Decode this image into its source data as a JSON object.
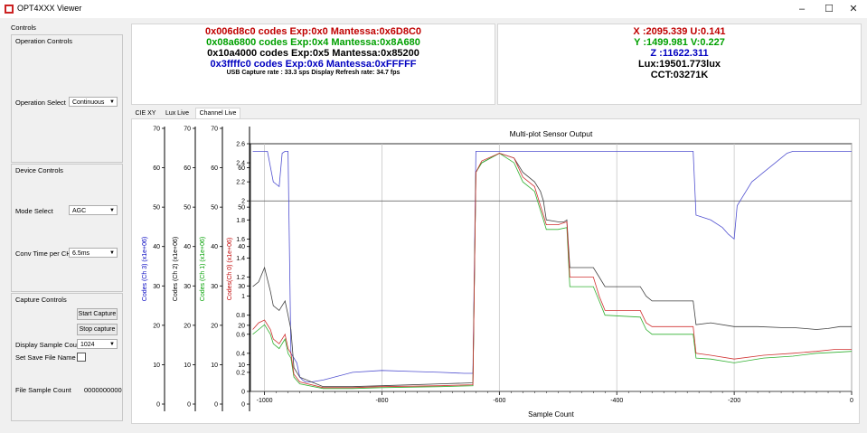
{
  "window": {
    "title": "OPT4XXX Viewer"
  },
  "controls": {
    "title": "Controls",
    "operation_group": "Operation Controls",
    "operation_select_label": "Operation Select",
    "operation_select_value": "Continuous",
    "device_group": "Device Controls",
    "mode_select_label": "Mode Select",
    "mode_select_value": "AGC",
    "conv_time_label": "Conv Time per CH",
    "conv_time_value": "6.5ms",
    "capture_group": "Capture Controls",
    "start_capture": "Start Capture",
    "stop_capture": "Stop capture",
    "display_sample_count_label": "Display Sample Count",
    "display_sample_count_value": "1024",
    "save_file_label": "Set Save File Name",
    "file_sample_count_label": "File Sample Count",
    "file_sample_count_value": "0000000000"
  },
  "readout": {
    "ch0": "0x006d8c0 codes Exp:0x0 Mantessa:0x6D8C0",
    "ch1": "0x08a6800 codes Exp:0x4 Mantessa:0x8A680",
    "ch2": "0x10a4000 codes Exp:0x5 Mantessa:0x85200",
    "ch3": "0x3ffffc0 codes Exp:0x6 Mantessa:0xFFFFF",
    "rates": "USB Capture rate : 33.3 sps Display Refresh rate: 34.7 fps",
    "xu": "X :2095.339 U:0.141",
    "yv": "Y :1499.981 V:0.227",
    "z": "Z :11622.311",
    "lux": "Lux:19501.773lux",
    "cct": "CCT:03271K"
  },
  "colors": {
    "ch0": "#c00000",
    "ch1": "#00a000",
    "ch2": "#000000",
    "ch3": "#0000c0"
  },
  "tabs": [
    "CIE XY",
    "Lux Live",
    "Channel Live"
  ],
  "chart_data": {
    "type": "line",
    "title": "Multi-plot Sensor Output",
    "xlabel": "Sample Count",
    "xlim": [
      -1024,
      0
    ],
    "xticks": [
      "-1000",
      "-800",
      "-600",
      "-400",
      "-200",
      "0"
    ],
    "yticks_main": [
      "0",
      "0.2",
      "0.4",
      "0.6",
      "0.8",
      "1",
      "1.2",
      "1.4",
      "1.6",
      "1.8",
      "2",
      "2.2",
      "2.4",
      "2.6"
    ],
    "ylim_main": [
      0,
      2.6
    ],
    "extra_axes": [
      {
        "label": "Codes (Ch 3) (x1e+06)",
        "color": "#0000c0",
        "ticks": [
          "0",
          "10",
          "20",
          "30",
          "40",
          "50",
          "60",
          "70"
        ]
      },
      {
        "label": "Codes (Ch 2) (x1e+06)",
        "color": "#000000",
        "ticks": [
          "0",
          "10",
          "20",
          "30",
          "40",
          "50",
          "60",
          "70"
        ]
      },
      {
        "label": "Codes (Ch 1) (x1e+06)",
        "color": "#00a000",
        "ticks": [
          "0",
          "10",
          "20",
          "30",
          "40",
          "50",
          "60",
          "70"
        ]
      },
      {
        "label": "Codes(Ch 0) (x1e+06)",
        "color": "#c00000",
        "ticks": [
          "0",
          "10",
          "20",
          "30",
          "40",
          "50",
          "60"
        ]
      }
    ],
    "series": [
      {
        "name": "Ch 3",
        "color": "#5050d0",
        "x": [
          -1020,
          -1010,
          -995,
          -985,
          -975,
          -970,
          -965,
          -960,
          -955,
          -950,
          -945,
          -940,
          -935,
          -930,
          -920,
          -900,
          -850,
          -800,
          -750,
          -700,
          -660,
          -645,
          -640,
          -635,
          -600,
          -550,
          -500,
          -400,
          -300,
          -270,
          -265,
          -240,
          -220,
          -210,
          -200,
          -195,
          -180,
          -170,
          -160,
          -150,
          -130,
          -110,
          -100,
          -80,
          -60,
          -30,
          0
        ],
        "y": [
          2.52,
          2.52,
          2.52,
          2.2,
          2.15,
          2.5,
          2.52,
          2.52,
          0.4,
          0.35,
          0.3,
          0.15,
          0.12,
          0.1,
          0.1,
          0.12,
          0.2,
          0.22,
          0.21,
          0.2,
          0.19,
          0.19,
          2.52,
          2.52,
          2.52,
          2.52,
          2.52,
          2.52,
          2.52,
          2.52,
          1.85,
          1.8,
          1.72,
          1.65,
          1.6,
          1.95,
          2.1,
          2.2,
          2.25,
          2.3,
          2.4,
          2.5,
          2.52,
          2.52,
          2.52,
          2.52,
          2.52
        ]
      },
      {
        "name": "Ch 2",
        "color": "#404040",
        "x": [
          -1020,
          -1010,
          -1000,
          -990,
          -985,
          -975,
          -965,
          -960,
          -955,
          -950,
          -940,
          -900,
          -850,
          -800,
          -700,
          -645,
          -640,
          -630,
          -600,
          -575,
          -560,
          -540,
          -530,
          -525,
          -520,
          -500,
          -490,
          -485,
          -480,
          -440,
          -430,
          -420,
          -360,
          -350,
          -340,
          -270,
          -265,
          -240,
          -200,
          -160,
          -120,
          -100,
          -80,
          -60,
          -40,
          -20,
          0
        ],
        "y": [
          1.1,
          1.15,
          1.3,
          1.05,
          0.9,
          0.85,
          0.95,
          0.8,
          0.65,
          0.25,
          0.15,
          0.05,
          0.05,
          0.06,
          0.08,
          0.09,
          2.3,
          2.4,
          2.5,
          2.45,
          2.3,
          2.2,
          2.1,
          2.0,
          1.8,
          1.78,
          1.78,
          1.8,
          1.3,
          1.3,
          1.2,
          1.1,
          1.1,
          1.0,
          0.95,
          0.95,
          0.7,
          0.72,
          0.68,
          0.68,
          0.67,
          0.67,
          0.66,
          0.65,
          0.66,
          0.68,
          0.68
        ]
      },
      {
        "name": "Ch 1",
        "color": "#30b030",
        "x": [
          -1020,
          -1010,
          -1000,
          -990,
          -985,
          -975,
          -965,
          -960,
          -955,
          -950,
          -940,
          -900,
          -850,
          -800,
          -700,
          -645,
          -640,
          -630,
          -600,
          -575,
          -560,
          -540,
          -530,
          -525,
          -520,
          -500,
          -485,
          -480,
          -440,
          -430,
          -420,
          -360,
          -350,
          -340,
          -270,
          -265,
          -240,
          -200,
          -150,
          -100,
          -60,
          -30,
          0
        ],
        "y": [
          0.6,
          0.65,
          0.7,
          0.6,
          0.5,
          0.45,
          0.55,
          0.4,
          0.35,
          0.15,
          0.08,
          0.03,
          0.03,
          0.04,
          0.05,
          0.06,
          2.3,
          2.4,
          2.5,
          2.4,
          2.2,
          2.1,
          1.9,
          1.8,
          1.7,
          1.7,
          1.72,
          1.1,
          1.1,
          0.95,
          0.8,
          0.78,
          0.65,
          0.6,
          0.6,
          0.35,
          0.34,
          0.3,
          0.35,
          0.37,
          0.4,
          0.41,
          0.42
        ]
      },
      {
        "name": "Ch 0",
        "color": "#d03030",
        "x": [
          -1020,
          -1010,
          -1000,
          -990,
          -985,
          -975,
          -965,
          -960,
          -955,
          -950,
          -940,
          -900,
          -850,
          -800,
          -700,
          -645,
          -640,
          -630,
          -600,
          -575,
          -560,
          -540,
          -530,
          -525,
          -520,
          -500,
          -485,
          -480,
          -440,
          -430,
          -420,
          -360,
          -350,
          -340,
          -270,
          -265,
          -240,
          -200,
          -150,
          -100,
          -60,
          -30,
          0
        ],
        "y": [
          0.65,
          0.72,
          0.75,
          0.65,
          0.55,
          0.5,
          0.6,
          0.45,
          0.4,
          0.18,
          0.1,
          0.04,
          0.04,
          0.05,
          0.06,
          0.07,
          2.3,
          2.42,
          2.5,
          2.45,
          2.25,
          2.15,
          1.95,
          1.85,
          1.75,
          1.75,
          1.78,
          1.2,
          1.2,
          1.0,
          0.85,
          0.85,
          0.72,
          0.68,
          0.68,
          0.4,
          0.38,
          0.34,
          0.38,
          0.4,
          0.42,
          0.44,
          0.44
        ]
      }
    ]
  }
}
